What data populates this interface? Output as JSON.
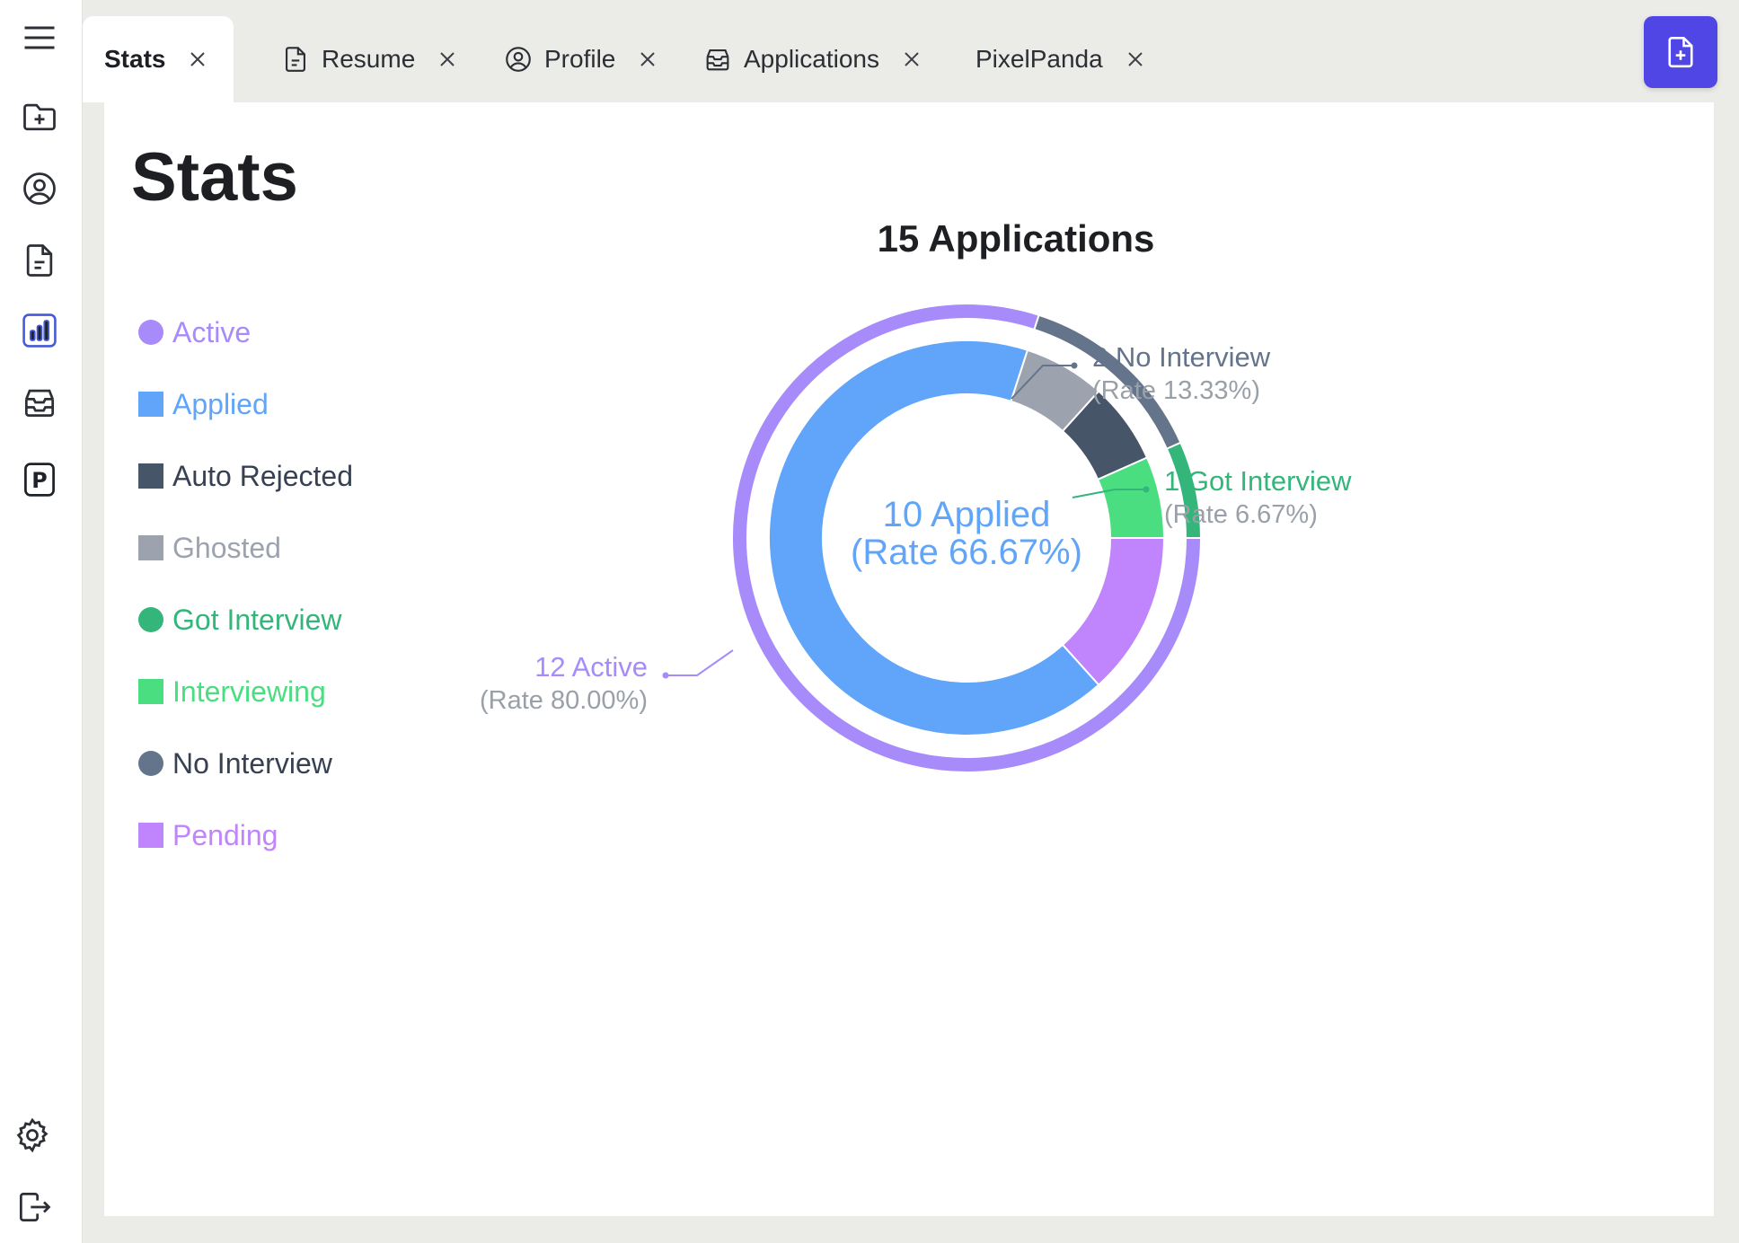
{
  "tabs": [
    {
      "label": "Stats",
      "icon": "",
      "active": true
    },
    {
      "label": "Resume",
      "icon": "document-icon",
      "active": false
    },
    {
      "label": "Profile",
      "icon": "user-circle-icon",
      "active": false
    },
    {
      "label": "Applications",
      "icon": "inbox-stack-icon",
      "active": false
    },
    {
      "label": "PixelPanda",
      "icon": "",
      "active": false
    }
  ],
  "rail": {
    "items": [
      {
        "name": "menu-icon",
        "active": false
      },
      {
        "name": "folder-add-icon",
        "active": false
      },
      {
        "name": "user-circle-icon",
        "active": false
      },
      {
        "name": "document-icon",
        "active": false
      },
      {
        "name": "bar-chart-icon",
        "active": true
      },
      {
        "name": "inbox-stack-icon",
        "active": false
      },
      {
        "name": "parking-p-icon",
        "active": false
      },
      {
        "name": "gear-icon",
        "active": false
      },
      {
        "name": "logout-icon",
        "active": false
      }
    ],
    "p_letter": "P"
  },
  "new_button_icon": "document-add-icon",
  "page": {
    "title": "Stats"
  },
  "legend": [
    {
      "label": "Active",
      "shape": "circle",
      "color": "#a78bfa"
    },
    {
      "label": "Applied",
      "shape": "square",
      "color": "#60a5fa"
    },
    {
      "label": "Auto Rejected",
      "shape": "square",
      "color": "#475569"
    },
    {
      "label": "Ghosted",
      "shape": "square",
      "color": "#9ca3af"
    },
    {
      "label": "Got Interview",
      "shape": "circle",
      "color": "#34b57a"
    },
    {
      "label": "Interviewing",
      "shape": "square",
      "color": "#4ade80"
    },
    {
      "label": "No Interview",
      "shape": "circle",
      "color": "#64748b"
    },
    {
      "label": "Pending",
      "shape": "square",
      "color": "#c084fc"
    }
  ],
  "legend_text_colors": [
    "#a78bfa",
    "#60a5fa",
    "#374151",
    "#9ca3af",
    "#34b57a",
    "#4ade80",
    "#374151",
    "#c084fc"
  ],
  "chart_data": {
    "type": "pie",
    "title": "15 Applications",
    "outer_ring": [
      {
        "name": "Active",
        "value": 12,
        "color": "#a78bfa"
      },
      {
        "name": "No Interview",
        "value": 2,
        "color": "#64748b"
      },
      {
        "name": "Got Interview",
        "value": 1,
        "color": "#34b57a"
      }
    ],
    "inner_ring": [
      {
        "name": "Applied",
        "value": 10,
        "color": "#60a5fa"
      },
      {
        "name": "Ghosted",
        "value": 1,
        "color": "#9ca3af"
      },
      {
        "name": "Auto Rejected",
        "value": 1,
        "color": "#475569"
      },
      {
        "name": "Interviewing",
        "value": 1,
        "color": "#4ade80"
      },
      {
        "name": "Pending",
        "value": 2,
        "color": "#c084fc"
      }
    ],
    "center_label": {
      "line1": "10 Applied",
      "line2": "(Rate 66.67%)",
      "color": "#60a5fa"
    },
    "callouts": [
      {
        "line1": "2 No Interview",
        "line2": "(Rate 13.33%)",
        "color": "#64748b"
      },
      {
        "line1": "1 Got Interview",
        "line2": "(Rate 6.67%)",
        "color": "#34b57a"
      },
      {
        "line1": "12 Active",
        "line2": "(Rate 80.00%)",
        "color": "#a78bfa"
      }
    ]
  }
}
